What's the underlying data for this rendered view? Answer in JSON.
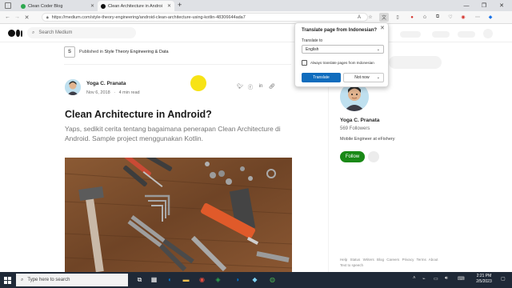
{
  "browser": {
    "tabs": [
      {
        "title": "Clean Coder Blog",
        "active": false
      },
      {
        "title": "Clean Architecture in Android? | S",
        "active": true
      }
    ],
    "new_tab": "+",
    "url": "https://medium.com/style-theory-engineering/android-clean-architecture-using-kotlin-48306644ada7",
    "window_controls": [
      "—",
      "❐",
      "✕"
    ]
  },
  "medium": {
    "search_placeholder": "Search Medium",
    "publication_prefix": "Published in ",
    "publication_name": "Style Theory Engineering & Data"
  },
  "article": {
    "author": "Yoga C. Pranata",
    "date": "Nov 6, 2018",
    "separator": "·",
    "read_time": "4 min read",
    "title": "Clean Architecture in Android?",
    "subtitle": "Yaps, sedikit cerita tentang bagaimana penerapan Clean Architecture di Android. Sample project menggunakan Kotlin."
  },
  "sidebar": {
    "name": "Yoga C. Pranata",
    "followers": "569 Followers",
    "bio": "Mobile Engineer at eFishery",
    "follow_label": "Follow",
    "footer_links": [
      "Help",
      "Status",
      "Writers",
      "Blog",
      "Careers",
      "Privacy",
      "Terms",
      "About",
      "Text to speech"
    ]
  },
  "translate_popup": {
    "title": "Translate page from Indonesian?",
    "translate_to_label": "Translate to",
    "selected_language": "English",
    "checkbox_label": "Always translate pages from Indonesian",
    "translate_button": "Translate",
    "not_now_button": "Not now"
  },
  "taskbar": {
    "search_placeholder": "Type here to search",
    "time": "2:21 PM",
    "date": "2/5/2023"
  },
  "colors": {
    "follow_green": "#1a8917",
    "translate_blue": "#0f6cbd",
    "taskbar": "#1f2937",
    "cursor_highlight": "#f7e10a"
  }
}
